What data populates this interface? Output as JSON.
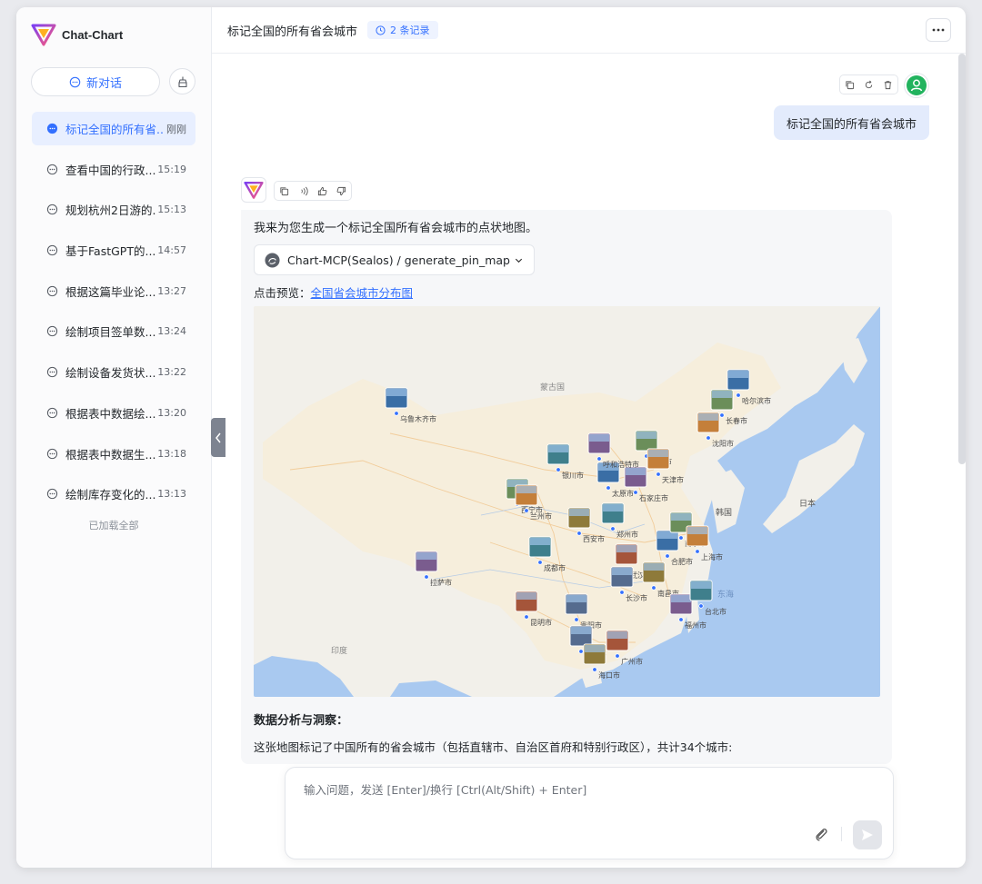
{
  "app": {
    "name": "Chat-Chart",
    "logo_icon": "chat-chart-logo-icon"
  },
  "sidebar": {
    "new_chat_label": "新对话",
    "items": [
      {
        "title": "标记全国的所有省...",
        "time": "刚刚",
        "active": true
      },
      {
        "title": "查看中国的行政...",
        "time": "15:19"
      },
      {
        "title": "规划杭州2日游的...",
        "time": "15:13"
      },
      {
        "title": "基于FastGPT的...",
        "time": "14:57"
      },
      {
        "title": "根据这篇毕业论...",
        "time": "13:27"
      },
      {
        "title": "绘制项目签单数...",
        "time": "13:24"
      },
      {
        "title": "绘制设备发货状...",
        "time": "13:22"
      },
      {
        "title": "根据表中数据绘...",
        "time": "13:20"
      },
      {
        "title": "根据表中数据生...",
        "time": "13:18"
      },
      {
        "title": "绘制库存变化的...",
        "time": "13:13"
      }
    ],
    "loaded_all": "已加载全部"
  },
  "header": {
    "title": "标记全国的所有省会城市",
    "records": "2 条记录"
  },
  "messages": {
    "user": "标记全国的所有省会城市",
    "ai": {
      "intro": "我来为您生成一个标记全国所有省会城市的点状地图。",
      "tool_call": "Chart-MCP(Sealos) / generate_pin_map",
      "preview_prefix": "点击预览：",
      "preview_link": "全国省会城市分布图",
      "section_title": "数据分析与洞察：",
      "paragraph": "这张地图标记了中国所有的省会城市（包括直辖市、自治区首府和特别行政区），共计34个城市:"
    }
  },
  "map_labels": {
    "urumqi": "乌鲁木齐市",
    "xining": "西宁市",
    "lanzhou": "兰州市",
    "lhasa": "拉萨市",
    "chengdu": "成都市",
    "kunming": "昆明市",
    "guiyang": "贵阳市",
    "xian": "西安市",
    "taiyuan": "太原市",
    "beijing": "北京市",
    "tianjin": "天津市",
    "shijiazhuang": "石家庄市",
    "zhengzhou": "郑州市",
    "wuhan": "武汉市",
    "changsha": "长沙市",
    "nanchang": "南昌市",
    "hefei": "合肥市",
    "nanjing": "南京市",
    "shanghai": "上海市",
    "fuzhou": "福州市",
    "taibei": "台北市",
    "guangzhou": "广州市",
    "nanning": "南宁市",
    "haikou": "海口市",
    "harbin": "哈尔滨市",
    "changchun": "长春市",
    "shenyang": "沈阳市",
    "hohhot": "呼和浩特市",
    "yinchuan": "银川市",
    "mongolia": "蒙古国",
    "korea": "韩国",
    "japan": "日本",
    "india": "印度",
    "sea": "东海"
  },
  "input": {
    "placeholder": "输入问题，发送 [Enter]/换行 [Ctrl(Alt/Shift) + Enter]"
  },
  "colors": {
    "accent": "#3370ff",
    "user_bubble": "#e3ebfc",
    "avatar_green": "#22b35e"
  }
}
